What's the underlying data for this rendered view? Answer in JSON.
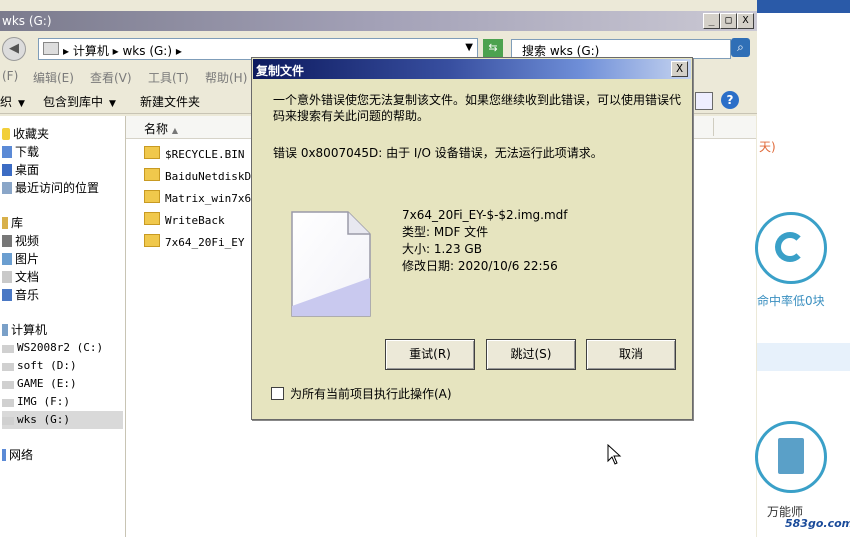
{
  "explorer": {
    "title": "wks (G:)",
    "title_buttons": [
      "_",
      "□",
      "X"
    ],
    "address": {
      "path": "▸ 计算机 ▸ wks (G:) ▸",
      "search_placeholder": "搜索 wks (G:)"
    },
    "menu": [
      "(F)",
      "编辑(E)",
      "查看(V)",
      "工具(T)",
      "帮助(H)"
    ],
    "toolbar": [
      "织",
      "包含到库中",
      "新建文件夹"
    ],
    "nav": {
      "favorites": "收藏夹",
      "favorites_items": [
        "下载",
        "桌面",
        "最近访问的位置"
      ],
      "libraries": "库",
      "libraries_items": [
        "视频",
        "图片",
        "文档",
        "音乐"
      ],
      "computer": "计算机",
      "drives": [
        "WS2008r2 (C:)",
        "soft (D:)",
        "GAME (E:)",
        "IMG (F:)",
        "wks (G:)"
      ],
      "network": "网络"
    },
    "column_name": "名称",
    "files": [
      "$RECYCLE.BIN",
      "BaiduNetdiskDow",
      "Matrix_win7x64",
      "WriteBack",
      "7x64_20Fi_EY"
    ]
  },
  "bgapp": {
    "warn_text": "天)",
    "label1": "命中率低0块",
    "label2": "万能师",
    "watermark": "583go.com"
  },
  "dialog": {
    "title": "复制文件",
    "close": "X",
    "message": "一个意外错误使您无法复制该文件。如果您继续收到此错误，可以使用错误代码来搜索有关此问题的帮助。",
    "error": "错误 0x8007045D: 由于 I/O 设备错误，无法运行此项请求。",
    "file": {
      "name": "7x64_20Fi_EY-$-$2.img.mdf",
      "type": "类型: MDF 文件",
      "size": "大小: 1.23 GB",
      "modified": "修改日期: 2020/10/6 22:56"
    },
    "buttons": {
      "retry": "重试(R)",
      "skip": "跳过(S)",
      "cancel": "取消"
    },
    "checkbox": "为所有当前项目执行此操作(A)"
  }
}
